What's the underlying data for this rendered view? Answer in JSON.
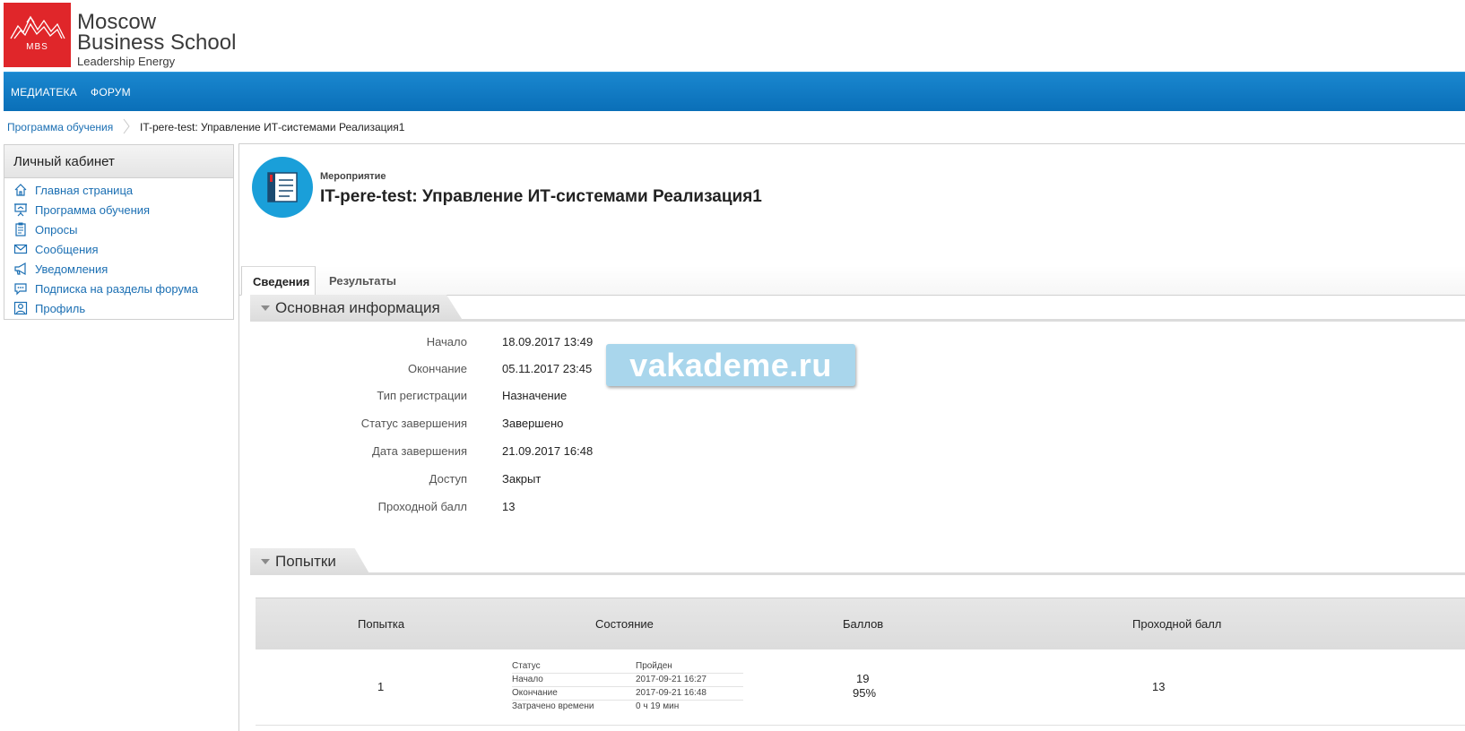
{
  "brand": {
    "logo_abbr": "MBS",
    "line1": "Moscow",
    "line2": "Business School",
    "tagline": "Leadership Energy",
    "accent_color": "#e0262a",
    "nav_color": "#0a7ac4"
  },
  "topnav": {
    "items": [
      "МЕДИАТЕКА",
      "ФОРУМ"
    ]
  },
  "breadcrumb": {
    "parent": "Программа обучения",
    "current": "IT-pere-test: Управление ИТ-системами Реализация1"
  },
  "sidebar": {
    "title": "Личный кабинет",
    "items": [
      {
        "label": "Главная страница",
        "icon": "home-icon"
      },
      {
        "label": "Программа обучения",
        "icon": "presentation-icon"
      },
      {
        "label": "Опросы",
        "icon": "clipboard-icon"
      },
      {
        "label": "Сообщения",
        "icon": "envelope-icon"
      },
      {
        "label": "Уведомления",
        "icon": "megaphone-icon"
      },
      {
        "label": "Подписка на разделы форума",
        "icon": "chat-bubble-icon"
      },
      {
        "label": "Профиль",
        "icon": "profile-icon"
      }
    ]
  },
  "event": {
    "type_label": "Мероприятие",
    "title": "IT-pere-test: Управление ИТ-системами Реализация1",
    "icon": "notebook-icon"
  },
  "tabs": [
    {
      "label": "Сведения",
      "active": true
    },
    {
      "label": "Результаты",
      "active": false
    }
  ],
  "main_info": {
    "title": "Основная информация",
    "rows": [
      {
        "label": "Начало",
        "value": "18.09.2017 13:49"
      },
      {
        "label": "Окончание",
        "value": "05.11.2017 23:45"
      },
      {
        "label": "Тип регистрации",
        "value": "Назначение"
      },
      {
        "label": "Статус завершения",
        "value": "Завершено"
      },
      {
        "label": "Дата завершения",
        "value": "21.09.2017 16:48"
      },
      {
        "label": "Доступ",
        "value": "Закрыт"
      },
      {
        "label": "Проходной балл",
        "value": "13"
      }
    ]
  },
  "watermark": "vakademe.ru",
  "attempts": {
    "title": "Попытки",
    "columns": [
      "Попытка",
      "Состояние",
      "Баллов",
      "Проходной балл"
    ],
    "rows": [
      {
        "attempt": "1",
        "state": [
          {
            "k": "Статус",
            "v": "Пройден"
          },
          {
            "k": "Начало",
            "v": "2017-09-21 16:27"
          },
          {
            "k": "Окончание",
            "v": "2017-09-21 16:48"
          },
          {
            "k": "Затрачено времени",
            "v": "0 ч 19 мин"
          }
        ],
        "score": "19",
        "score_percent": "95%",
        "passing_score": "13"
      }
    ]
  }
}
